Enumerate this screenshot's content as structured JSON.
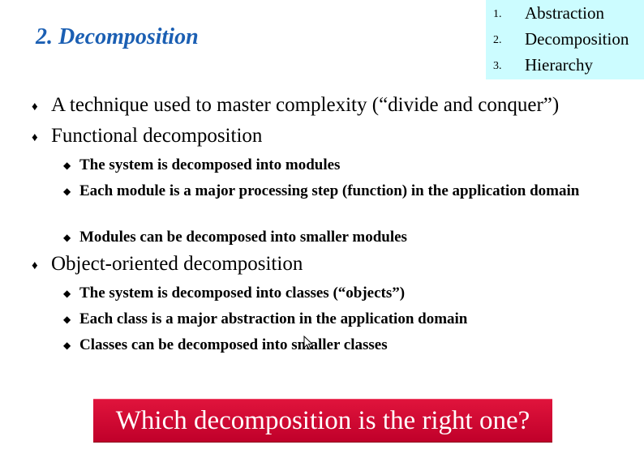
{
  "slide": {
    "title": "2. Decomposition"
  },
  "toc": {
    "items": [
      {
        "num": "1.",
        "label": "Abstraction"
      },
      {
        "num": "2.",
        "label": "Decomposition"
      },
      {
        "num": "3.",
        "label": "Hierarchy"
      }
    ]
  },
  "bullets": {
    "b1": "A technique used to master complexity (“divide and conquer”)",
    "b2": "Functional decomposition",
    "b2_sub": [
      "The system is decomposed into modules",
      "Each module is a major processing step (function) in the application domain",
      "Modules can be decomposed into smaller modules"
    ],
    "b3": "Object-oriented decomposition",
    "b3_sub": [
      "The system is decomposed into classes (“objects”)",
      "Each class is a major abstraction in the application domain",
      "Classes can be decomposed into smaller classes"
    ]
  },
  "callout": {
    "text": "Which decomposition is the right one?"
  },
  "markers": {
    "level1": "♦",
    "level2": "◆"
  },
  "colors": {
    "title": "#1b5fb3",
    "toc_bg": "#ccfcff",
    "callout_bg": "#d8103a",
    "callout_text": "#ffffff"
  },
  "icons": {
    "cursor": "mouse-pointer-icon"
  }
}
